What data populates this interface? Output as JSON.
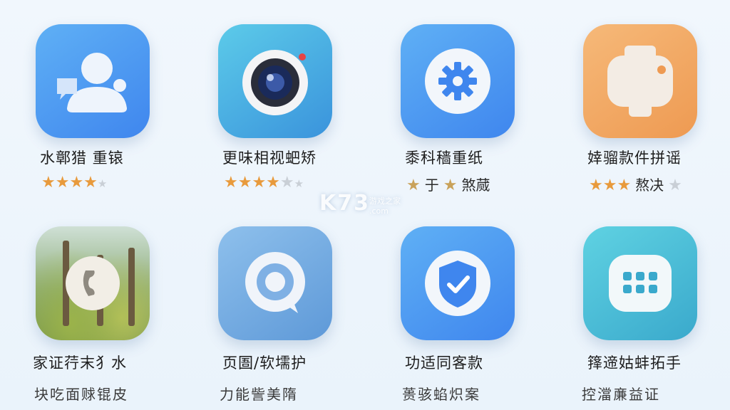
{
  "apps_row1": [
    {
      "title": "水鄣猎 重锿",
      "rating_text": "",
      "stars": {
        "on": 4,
        "off": 1
      }
    },
    {
      "title": "更味相视蚆矫",
      "rating_text": "",
      "stars": {
        "on": 4,
        "off": 2
      }
    },
    {
      "title": "黍科穑重纸",
      "rating_parts": [
        "于",
        "煞蒇"
      ]
    },
    {
      "title": "婞骝款件拼谣",
      "rating_parts": [
        "熬决"
      ]
    }
  ],
  "apps_row2": [
    {
      "title": "家证荇末犭水",
      "subtitle": "块吃面赇锟皮"
    },
    {
      "title": "页圄/软壖护",
      "subtitle": "力能訾美隋"
    },
    {
      "title": "功适同客款",
      "subtitle": "蒉骇蜭炽案"
    },
    {
      "title": "箨遆姑蚌拓手",
      "subtitle": "控澢亷益证"
    }
  ],
  "icons": [
    "contacts-icon",
    "camera-icon",
    "settings-gear-icon",
    "clipboard-icon",
    "phone-icon",
    "chat-bubble-icon",
    "shield-check-icon",
    "app-grid-icon"
  ],
  "colors": {
    "star": "#e89a3c",
    "star_off": "#c9cfd6",
    "blue": "#4a90e2"
  },
  "watermark": {
    "brand": "K73",
    "sub": "游戏之家",
    "domain": ".com"
  }
}
